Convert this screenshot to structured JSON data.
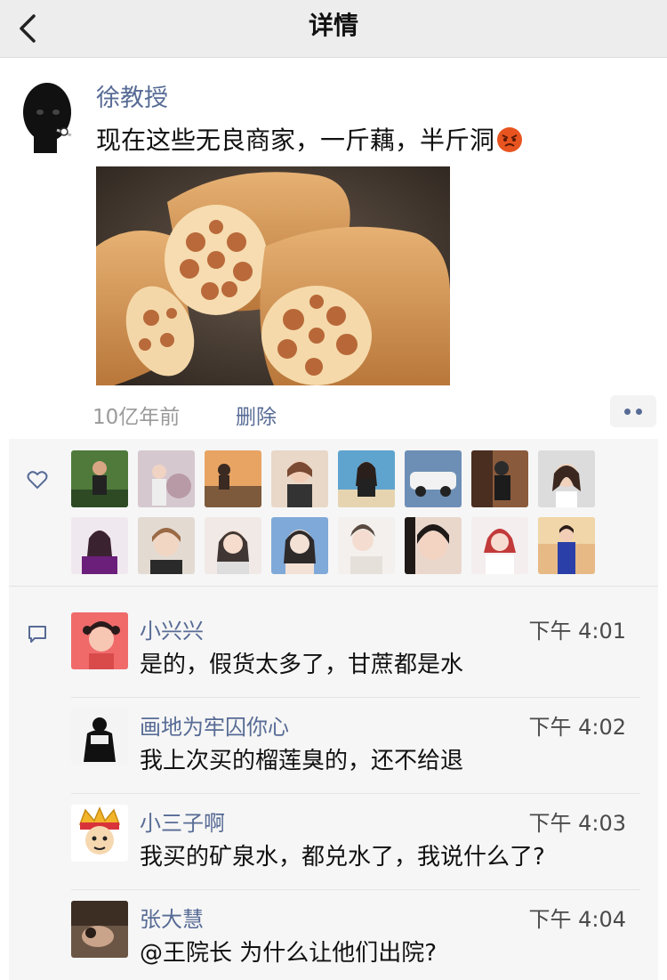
{
  "nav": {
    "title": "详情"
  },
  "post": {
    "author": "徐教授",
    "text": "现在这些无良商家，一斤藕，半斤洞",
    "time": "10亿年前",
    "delete_label": "删除"
  },
  "comments": [
    {
      "name": "小兴兴",
      "time": "下午 4:01",
      "text": "是的，假货太多了，甘蔗都是水"
    },
    {
      "name": "画地为牢囚你心",
      "time": "下午 4:02",
      "text": "我上次买的榴莲臭的，还不给退"
    },
    {
      "name": "小三子啊",
      "time": "下午 4:03",
      "text": "我买的矿泉水，都兑水了，我说什么了?"
    },
    {
      "name": "张大慧",
      "time": "下午 4:04",
      "text": "@王院长 为什么让他们出院?"
    }
  ],
  "colors": {
    "link": "#576b95",
    "navbar": "#ededed",
    "panel": "#f6f6f6"
  }
}
